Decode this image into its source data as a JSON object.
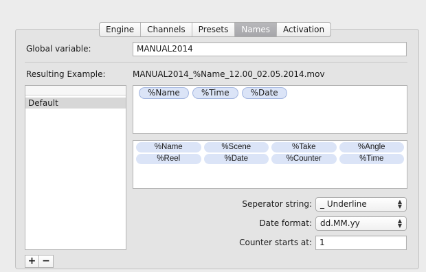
{
  "tabs": [
    {
      "label": "Engine",
      "selected": false
    },
    {
      "label": "Channels",
      "selected": false
    },
    {
      "label": "Presets",
      "selected": false
    },
    {
      "label": "Names",
      "selected": true
    },
    {
      "label": "Activation",
      "selected": false
    }
  ],
  "global_variable": {
    "label": "Global variable:",
    "value": "MANUAL2014"
  },
  "resulting_example": {
    "label": "Resulting Example:",
    "value": "MANUAL2014_%Name_12.00_02.05.2014.mov"
  },
  "presets_list": {
    "items": [
      {
        "label": "Default",
        "selected": true
      }
    ]
  },
  "list_buttons": {
    "add_label": "+",
    "remove_label": "−"
  },
  "active_tokens": [
    "%Name",
    "%Time",
    "%Date"
  ],
  "available_tokens": [
    "%Name",
    "%Scene",
    "%Take",
    "%Angle",
    "%Reel",
    "%Date",
    "%Counter",
    "%Time"
  ],
  "separator": {
    "label": "Seperator string:",
    "value": "_ Underline"
  },
  "date_format": {
    "label": "Date format:",
    "value": "dd.MM.yy"
  },
  "counter": {
    "label": "Counter starts at:",
    "value": "1"
  },
  "colors": {
    "token_fill": "#dbe4f7",
    "selected_tab": "#a9a9ad"
  }
}
